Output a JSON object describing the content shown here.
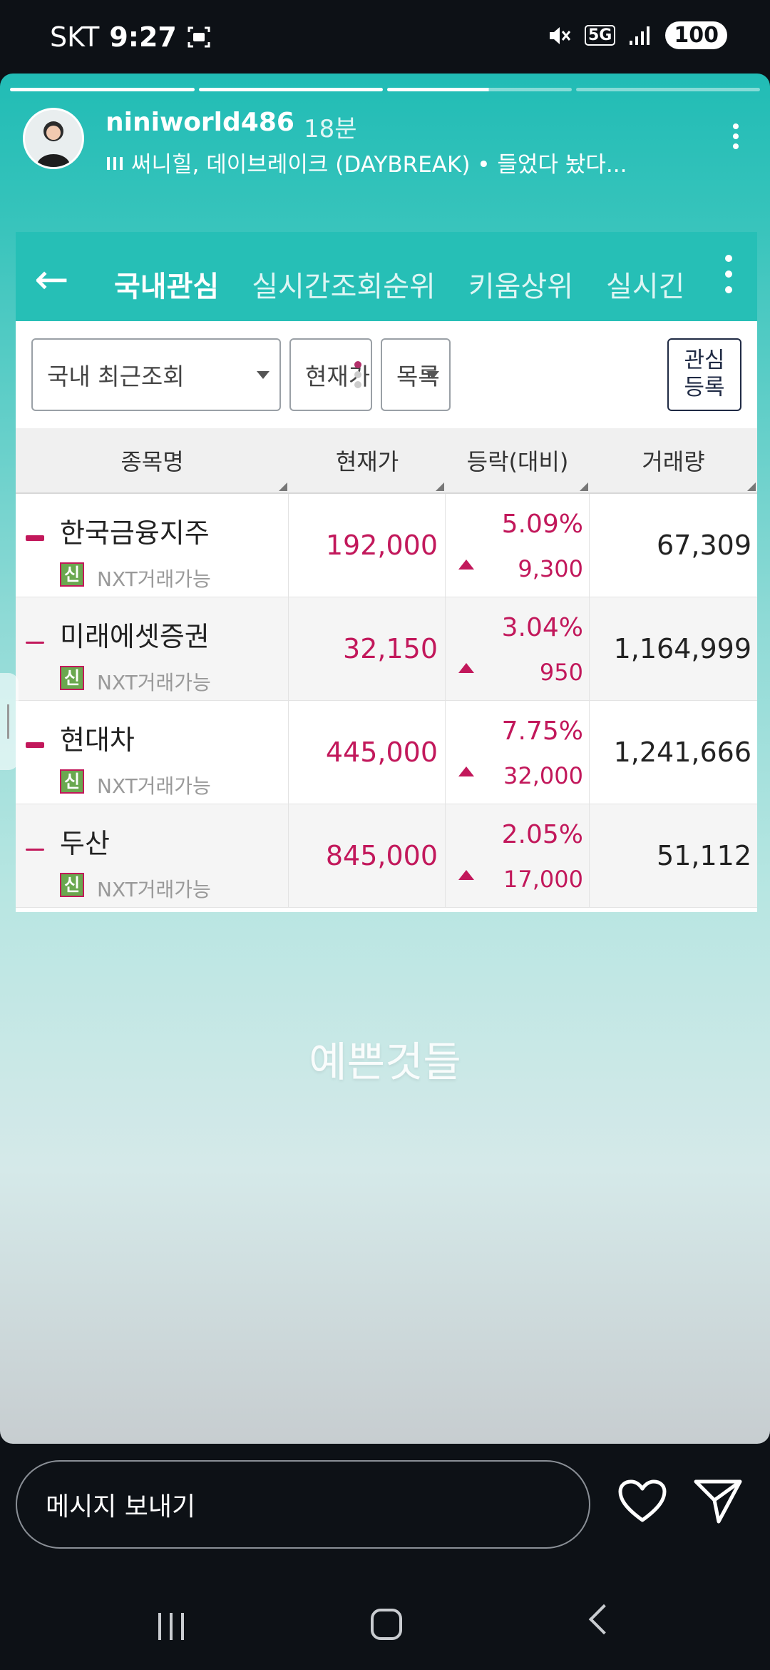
{
  "status_bar": {
    "carrier": "SKT",
    "time": "9:27",
    "network": "5G",
    "battery": "100"
  },
  "story": {
    "progress_segments": [
      1,
      1,
      0.55,
      0
    ],
    "username": "niniworld486",
    "time_ago": "18분",
    "music": "써니힐, 데이브레이크 (DAYBREAK) • 들었다 놨다...",
    "caption": "예쁜것들"
  },
  "app": {
    "tabs": [
      "국내관심",
      "실시간조회순위",
      "키움상위",
      "실시긴"
    ],
    "filter_group": "국내 최근조회",
    "filter_price": "현재가",
    "filter_list": "목록",
    "register_line1": "관심",
    "register_line2": "등록",
    "columns": [
      "종목명",
      "현재가",
      "등락(대비)",
      "거래량"
    ],
    "badge_label": "신",
    "nxt_label": "NXT거래가능",
    "rows": [
      {
        "name": "한국금융지주",
        "price": "192,000",
        "pct": "5.09%",
        "diff": "9,300",
        "volume": "67,309"
      },
      {
        "name": "미래에셋증권",
        "price": "32,150",
        "pct": "3.04%",
        "diff": "950",
        "volume": "1,164,999"
      },
      {
        "name": "현대차",
        "price": "445,000",
        "pct": "7.75%",
        "diff": "32,000",
        "volume": "1,241,666"
      },
      {
        "name": "두산",
        "price": "845,000",
        "pct": "2.05%",
        "diff": "17,000",
        "volume": "51,112"
      }
    ]
  },
  "reply": {
    "placeholder": "메시지 보내기"
  },
  "colors": {
    "teal": "#26bfb6",
    "up_red": "#c2185b"
  }
}
